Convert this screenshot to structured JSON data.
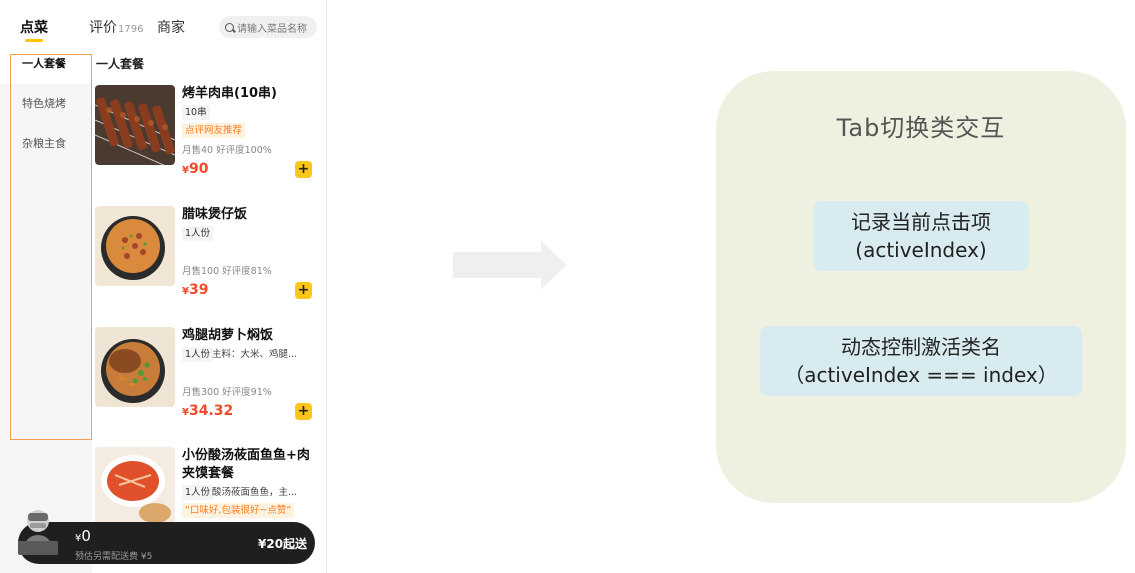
{
  "nav": {
    "tabs": [
      {
        "label": "点菜",
        "active": true
      },
      {
        "label": "评价",
        "count": "1796",
        "active": false
      },
      {
        "label": "商家",
        "active": false
      }
    ],
    "search_placeholder": "请输入菜品名称"
  },
  "sidebar": {
    "items": [
      {
        "label": "一人套餐",
        "active": true
      },
      {
        "label": "特色烧烤",
        "active": false
      },
      {
        "label": "杂粮主食",
        "active": false
      }
    ]
  },
  "menu": {
    "section_title": "一人套餐",
    "dishes": [
      {
        "name": "烤羊肉串(10串)",
        "tag": "10串",
        "promo": "点评网友推荐",
        "sales": "月售40  好评度100%",
        "currency": "¥",
        "price": "90"
      },
      {
        "name": "腊味煲仔饭",
        "tag": "1人份",
        "sales": "月售100  好评度81%",
        "currency": "¥",
        "price": "39"
      },
      {
        "name": "鸡腿胡萝卜焖饭",
        "tag": "1人份",
        "desc": "主料：大米、鸡腿...",
        "sales": "月售300  好评度91%",
        "currency": "¥",
        "price": "34.32"
      },
      {
        "name": "小份酸汤莜面鱼鱼+肉夹馍套餐",
        "tag": "1人份",
        "desc": "酸汤莜面鱼鱼，主...",
        "promo": "“口味好,包装很好~点赞”"
      }
    ]
  },
  "cart": {
    "currency": "¥",
    "total": "0",
    "delivery_note": "预估另需配送费 ¥5",
    "min_order": "¥20起送"
  },
  "concept": {
    "title": "Tab切换类交互",
    "point1_line1": "记录当前点击项",
    "point1_line2": "(activeIndex)",
    "point2_line1": "动态控制激活类名",
    "point2_line2": "（activeIndex === index）"
  },
  "colors": {
    "accent_yellow": "#ffc300",
    "price_red": "#f04a2a",
    "highlight_orange": "#f0a050",
    "card_bg": "#eef1df",
    "concept_bg": "#d8ebf0"
  }
}
